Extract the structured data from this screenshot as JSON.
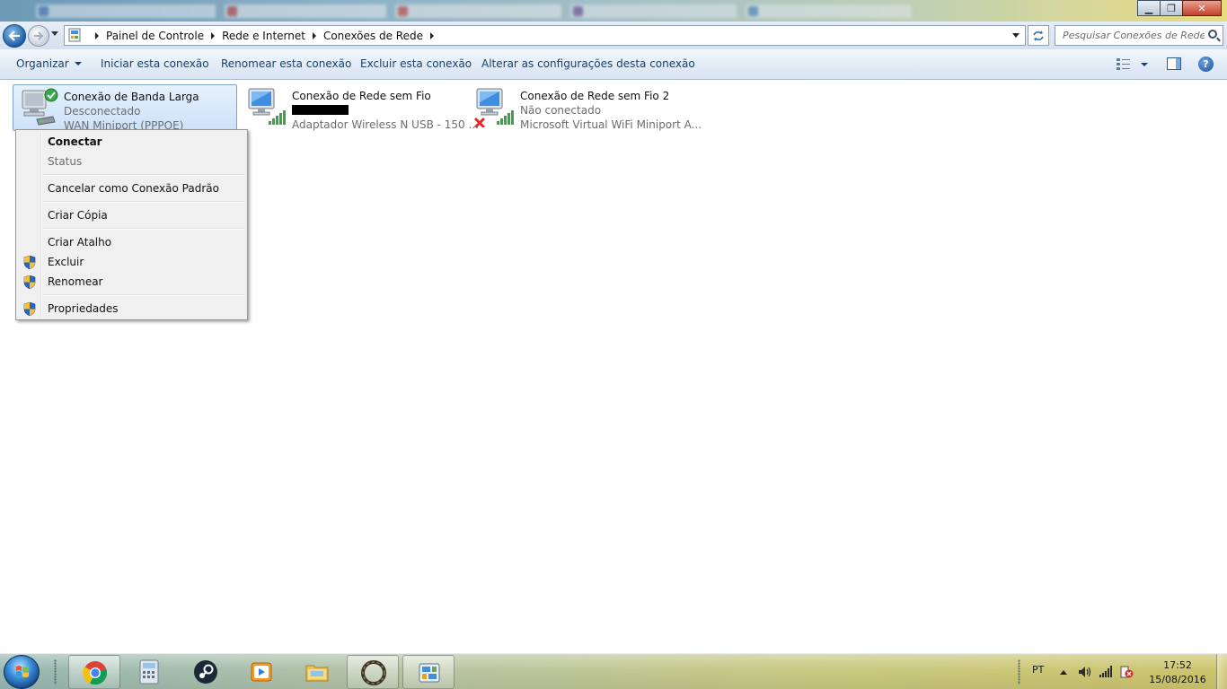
{
  "address": {
    "crumbs": [
      "Painel de Controle",
      "Rede e Internet",
      "Conexões de Rede"
    ],
    "search_placeholder": "Pesquisar Conexões de Rede"
  },
  "commands": {
    "organize": "Organizar",
    "start_connection": "Iniciar esta conexão",
    "rename_connection": "Renomear esta conexão",
    "delete_connection": "Excluir esta conexão",
    "change_settings": "Alterar as configurações desta conexão"
  },
  "connections": [
    {
      "name": "Conexão de Banda Larga",
      "status": "Desconectado",
      "device": "WAN Miniport (PPPOE)"
    },
    {
      "name": "Conexão de Rede sem Fio",
      "status": "",
      "device": "Adaptador Wireless N USB - 150 ..."
    },
    {
      "name": "Conexão de Rede sem Fio 2",
      "status": "Não conectado",
      "device": "Microsoft Virtual WiFi Miniport A..."
    }
  ],
  "context_menu": {
    "connect": "Conectar",
    "status": "Status",
    "cancel_default": "Cancelar como Conexão Padrão",
    "create_copy": "Criar Cópia",
    "create_shortcut": "Criar Atalho",
    "delete": "Excluir",
    "rename": "Renomear",
    "properties": "Propriedades"
  },
  "taskbar": {
    "language": "PT",
    "time": "17:52",
    "date": "15/08/2016",
    "pinned": [
      "chrome-icon",
      "calculator-icon",
      "steam-icon",
      "media-player-icon",
      "explorer-icon",
      "app-ring-icon",
      "control-panel-icon"
    ]
  },
  "colors": {
    "command_text": "#1e3f66",
    "status_text": "#6d6d6d",
    "selection_border": "#7da2ce"
  }
}
